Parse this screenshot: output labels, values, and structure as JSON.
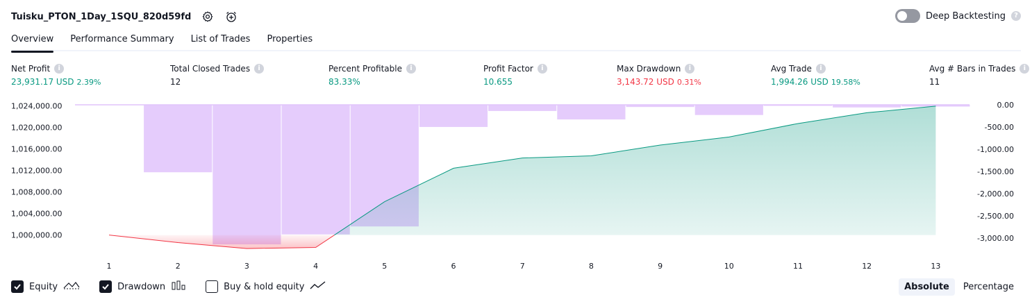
{
  "header": {
    "strategy_name": "Tuisku_PTON_1Day_1SQU_820d59fd",
    "settings_icon": "gear-icon",
    "alert_icon": "alarm-clock-plus-icon"
  },
  "deep_backtesting": {
    "label": "Deep Backtesting",
    "enabled": false,
    "help": "?"
  },
  "tabs": [
    {
      "label": "Overview",
      "active": true
    },
    {
      "label": "Performance Summary",
      "active": false
    },
    {
      "label": "List of Trades",
      "active": false
    },
    {
      "label": "Properties",
      "active": false
    }
  ],
  "metrics": [
    {
      "label": "Net Profit",
      "value": "23,931.17 USD",
      "pct": "2.39%",
      "color": "#089981"
    },
    {
      "label": "Total Closed Trades",
      "value": "12",
      "pct": "",
      "color": "#131722"
    },
    {
      "label": "Percent Profitable",
      "value": "83.33%",
      "pct": "",
      "color": "#089981"
    },
    {
      "label": "Profit Factor",
      "value": "10.655",
      "pct": "",
      "color": "#089981"
    },
    {
      "label": "Max Drawdown",
      "value": "3,143.72 USD",
      "pct": "0.31%",
      "color": "#f23645"
    },
    {
      "label": "Avg Trade",
      "value": "1,994.26 USD",
      "pct": "19.58%",
      "color": "#089981"
    },
    {
      "label": "Avg # Bars in Trades",
      "value": "11",
      "pct": "",
      "color": "#131722"
    }
  ],
  "chart_data": {
    "type": "line",
    "x": [
      1,
      2,
      3,
      4,
      5,
      6,
      7,
      8,
      9,
      10,
      11,
      12,
      13
    ],
    "left_axis_ticks": [
      "1,024,000.00",
      "1,020,000.00",
      "1,016,000.00",
      "1,012,000.00",
      "1,008,000.00",
      "1,004,000.00",
      "1,000,000.00"
    ],
    "left_axis_values": [
      1024000,
      1020000,
      1016000,
      1012000,
      1008000,
      1004000,
      1000000
    ],
    "right_axis_ticks": [
      "0.00",
      "-500.00",
      "-1,000.00",
      "-1,500.00",
      "-2,000.00",
      "-2,500.00",
      "-3,000.00"
    ],
    "right_axis_values": [
      0,
      -500,
      -1000,
      -1500,
      -2000,
      -2500,
      -3000
    ],
    "ylim_left": [
      998800,
      1024300
    ],
    "ylim_right": [
      -3080,
      15
    ],
    "series": [
      {
        "name": "Equity",
        "values": [
          1000000,
          998600,
          997500,
          997700,
          1006200,
          1012400,
          1014300,
          1014700,
          1016700,
          1018200,
          1020700,
          1022700,
          1023931
        ]
      },
      {
        "name": "Drawdown",
        "values": [
          0,
          -1520,
          -3144,
          -2920,
          -2740,
          -500,
          -140,
          -330,
          -50,
          -230,
          -20,
          -60,
          -40
        ]
      }
    ],
    "colors": {
      "equity_up": "#089981",
      "equity_down": "#f23645",
      "drawdown": "#e1c3fc",
      "buy_hold": "#131722"
    }
  },
  "legend": [
    {
      "label": "Equity",
      "checked": true,
      "icon": "equity-line-icon"
    },
    {
      "label": "Drawdown",
      "checked": true,
      "icon": "drawdown-bars-icon"
    },
    {
      "label": "Buy & hold equity",
      "checked": false,
      "icon": "buy-hold-line-icon"
    }
  ],
  "modes": [
    {
      "label": "Absolute",
      "active": true
    },
    {
      "label": "Percentage",
      "active": false
    }
  ]
}
